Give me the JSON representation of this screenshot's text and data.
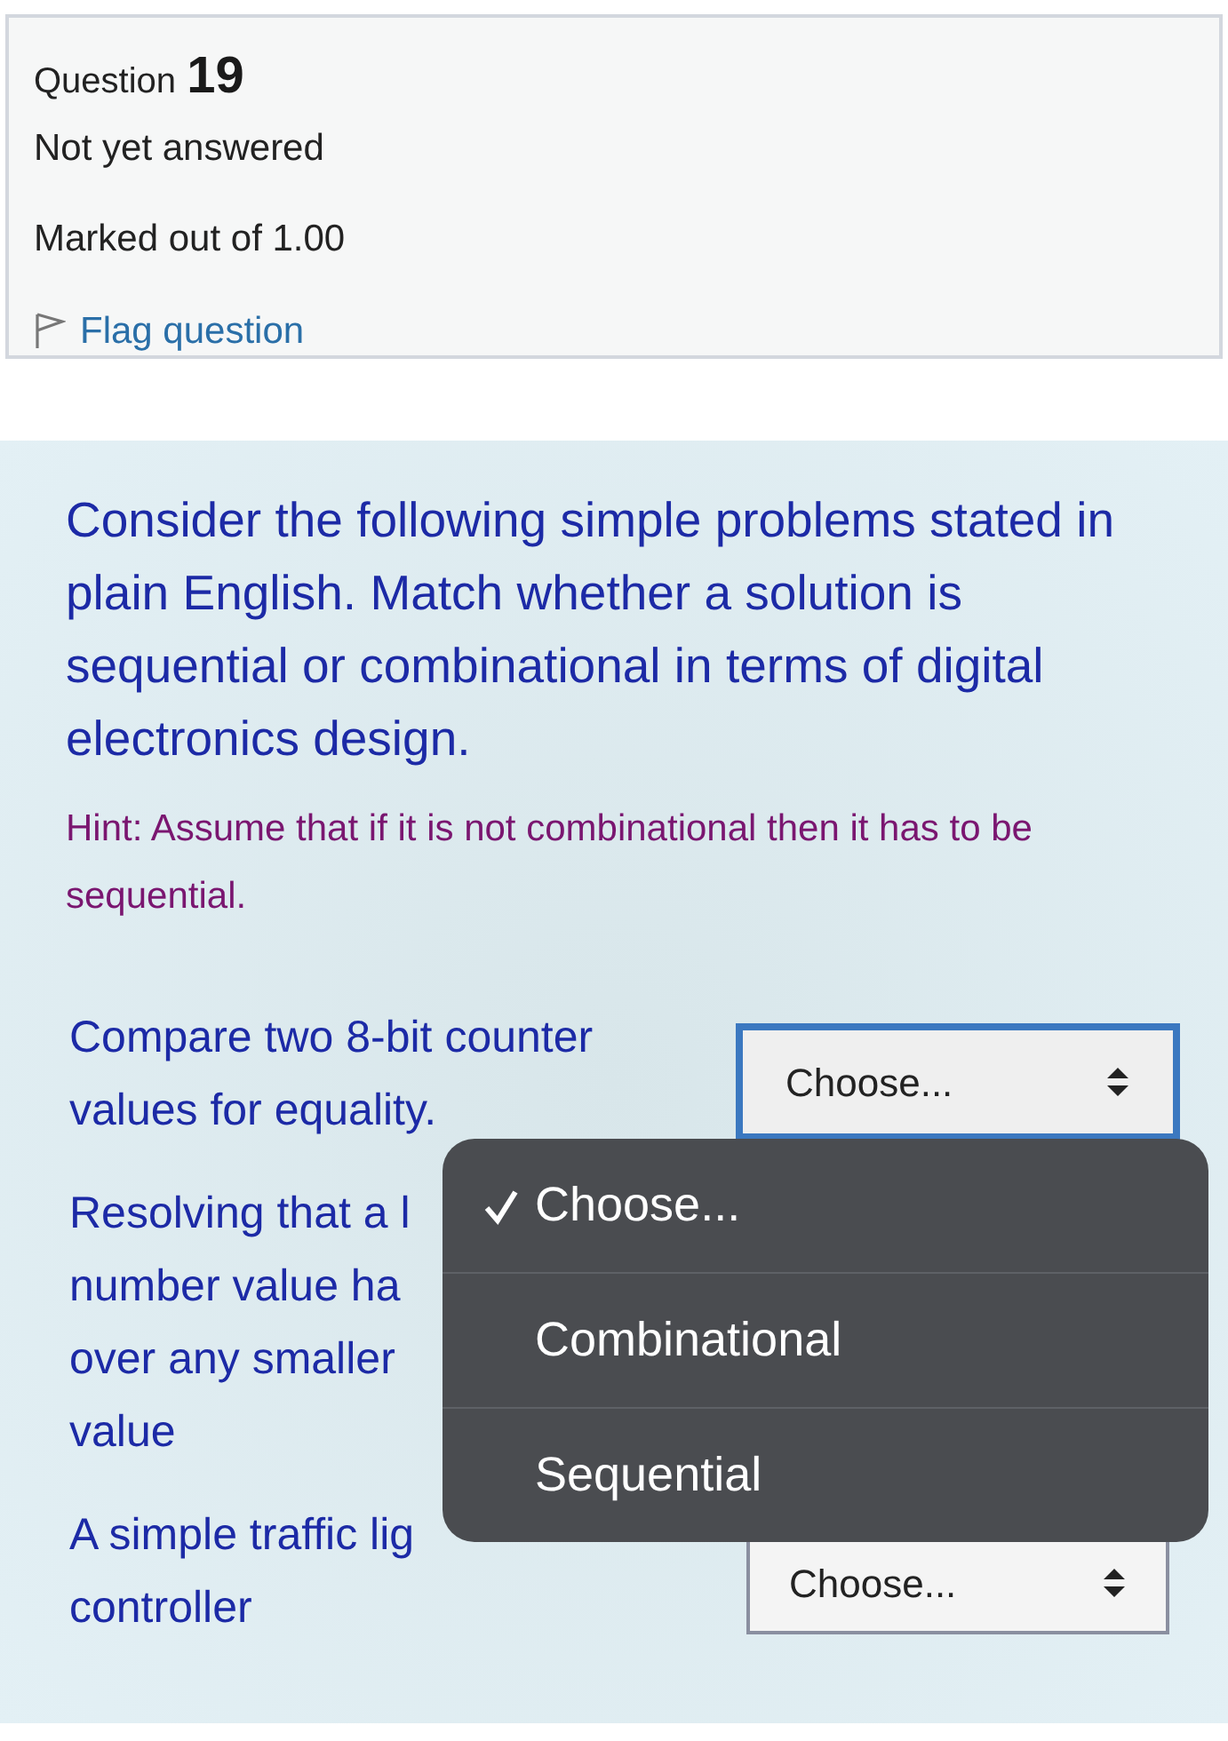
{
  "info": {
    "label": "Question",
    "number": "19",
    "status": "Not yet answered",
    "marks": "Marked out of 1.00",
    "flag": {
      "label": "Flag question",
      "flagged": false
    }
  },
  "question": {
    "text": "Consider the following simple problems stated in plain English. Match whether a solution is sequential or combinational in terms of digital electronics design.",
    "hint": "Hint: Assume that if it is not combinational then it has to be sequential."
  },
  "matches": [
    {
      "prompt_lines": [
        "Compare two 8-bit counter",
        "values for equality."
      ],
      "select": {
        "value": "Choose...",
        "focused": true
      }
    },
    {
      "prompt_lines": [
        "Resolving that a l",
        "number value ha",
        "over any smaller",
        "value"
      ]
    },
    {
      "prompt_lines": [
        "A simple traffic lig",
        "controller"
      ],
      "select": {
        "value": "Choose...",
        "focused": false
      }
    }
  ],
  "menu": {
    "options": [
      {
        "label": "Choose...",
        "selected": true
      },
      {
        "label": "Combinational",
        "selected": false
      },
      {
        "label": "Sequential",
        "selected": false
      }
    ]
  }
}
